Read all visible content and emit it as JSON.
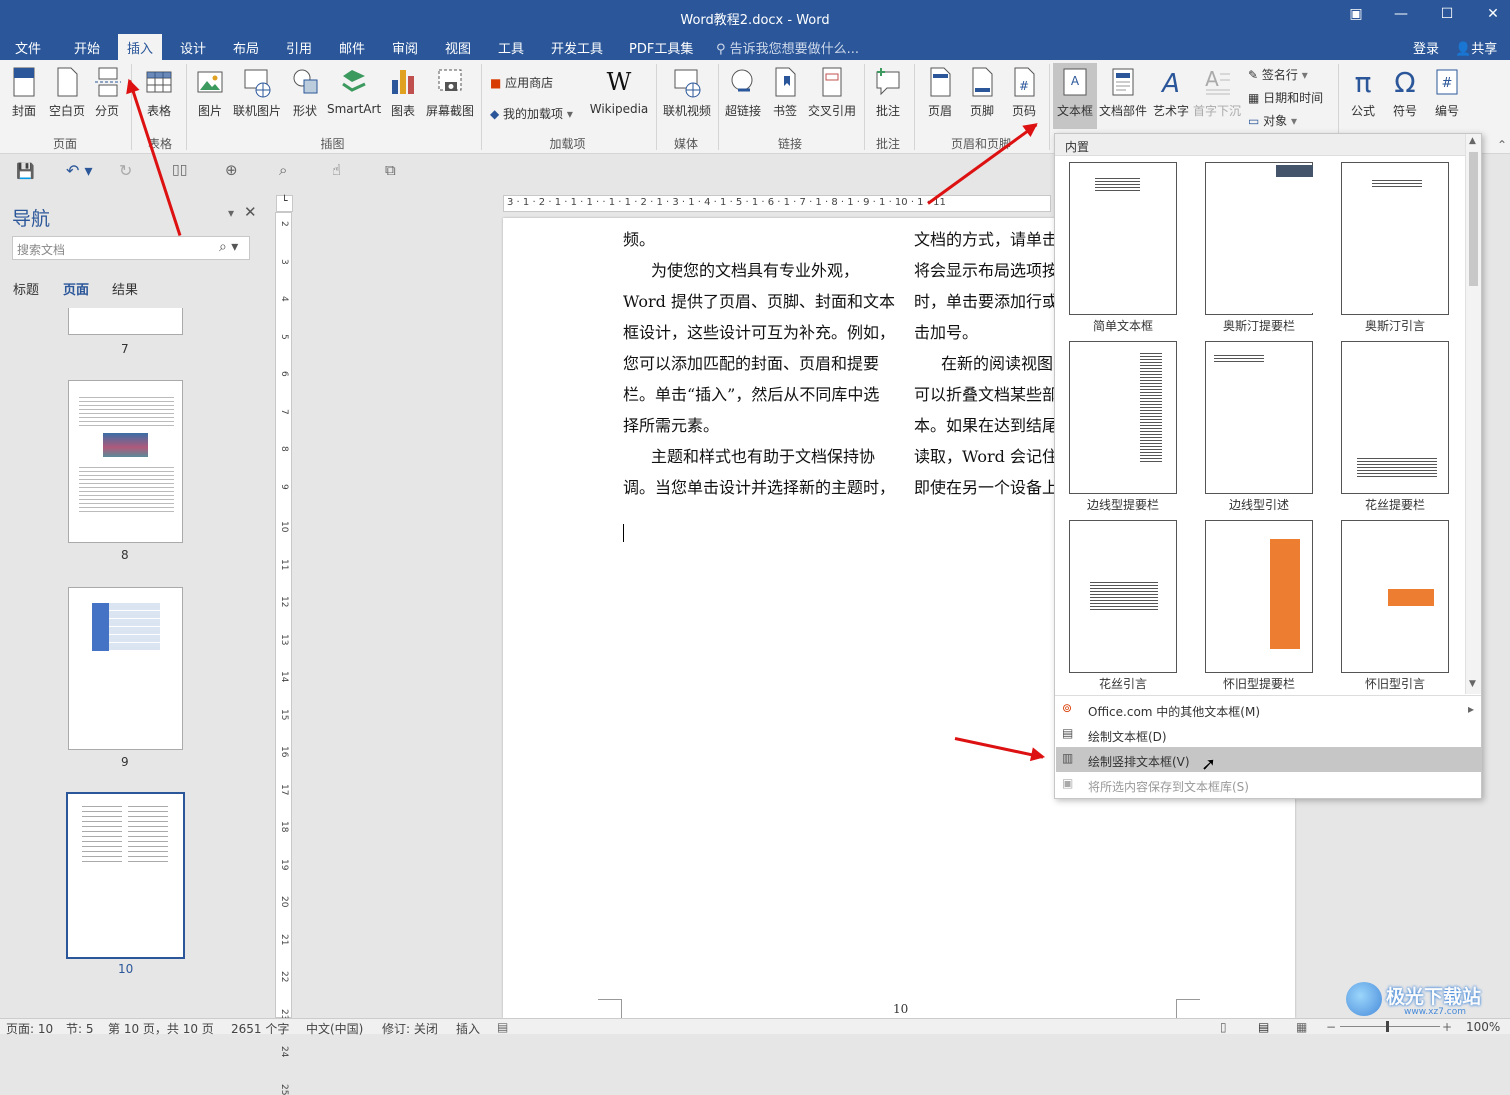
{
  "titlebar": {
    "title": "Word教程2.docx - Word",
    "restore": "▣",
    "minimize": "—",
    "maximize": "☐",
    "close": "✕"
  },
  "menu": {
    "tabs": [
      "文件",
      "开始",
      "插入",
      "设计",
      "布局",
      "引用",
      "邮件",
      "审阅",
      "视图",
      "工具",
      "开发工具",
      "PDF工具集"
    ],
    "tell_me": "告诉我您想要做什么...",
    "login": "登录",
    "share": "共享"
  },
  "ribbon": {
    "pages": [
      "封面",
      "空白页",
      "分页"
    ],
    "pages_group": "页面",
    "table": "表格",
    "table_group": "表格",
    "illus": [
      "图片",
      "联机图片",
      "形状",
      "SmartArt",
      "图表",
      "屏幕截图"
    ],
    "illus_group": "插图",
    "addins": {
      "store": "应用商店",
      "my": "我的加载项",
      "wiki": "Wikipedia",
      "group": "加载项"
    },
    "media": "联机视频",
    "media_group": "媒体",
    "links": [
      "超链接",
      "书签",
      "交叉引用"
    ],
    "links_group": "链接",
    "comment": "批注",
    "comment_group": "批注",
    "hf": [
      "页眉",
      "页脚",
      "页码"
    ],
    "hf_group": "页眉和页脚",
    "text": [
      "文本框",
      "文档部件",
      "艺术字",
      "首字下沉"
    ],
    "text_small": [
      "签名行",
      "日期和时间",
      "对象"
    ],
    "symbols": [
      "公式",
      "符号",
      "编号"
    ]
  },
  "nav": {
    "title": "导航",
    "search_placeholder": "搜索文档",
    "tabs": [
      "标题",
      "页面",
      "结果"
    ],
    "pages": [
      "7",
      "8",
      "9",
      "10"
    ]
  },
  "doc": {
    "col1": [
      "频。",
      "为使您的文档具有专业外观，",
      "Word 提供了页眉、页脚、封面和文本",
      "框设计，这些设计可互为补充。例如，",
      "您可以添加匹配的封面、页眉和提要",
      "栏。单击“插入”，然后从不同库中选",
      "择所需元素。",
      "主题和样式也有助于文档保持协",
      "调。当您单击设计并选择新的主题时，"
    ],
    "col2": [
      "文档的方式，请单击",
      "将会显示布局选项按",
      "时，单击要添加行或",
      "击加号。",
      "在新的阅读视图",
      "可以折叠文档某些部",
      "本。如果在达到结尾",
      "读取，Word 会记住",
      "即使在另一个设备上"
    ],
    "page_number": "10",
    "ruler": "3 · 1 · 2 · 1 · 1 · 1 ·  · 1 · 1 · 2 · 1 · 3 · 1 · 4 · 1 · 5 · 1 · 6 · 1 · 7 · 1 · 8 · 1 · 9 · 1 · 10 · 1 · 11"
  },
  "gallery": {
    "header": "内置",
    "items": [
      "简单文本框",
      "奥斯汀提要栏",
      "奥斯汀引言",
      "边线型提要栏",
      "边线型引述",
      "花丝提要栏",
      "花丝引言",
      "怀旧型提要栏",
      "怀旧型引言"
    ],
    "menu": [
      "Office.com 中的其他文本框(M)",
      "绘制文本框(D)",
      "绘制竖排文本框(V)",
      "将所选内容保存到文本框库(S)"
    ]
  },
  "status": {
    "page": "页面: 10",
    "section": "节: 5",
    "pages": "第 10 页，共 10 页",
    "words": "2651 个字",
    "lang": "中文(中国)",
    "track": "修订: 关闭",
    "mode": "插入",
    "zoom": "100%"
  },
  "watermark": "极光下载站",
  "watermark_url": "www.xz7.com",
  "colors": {
    "accent": "#2b579a",
    "arrow": "#dd1111",
    "orange": "#ed7d31"
  }
}
